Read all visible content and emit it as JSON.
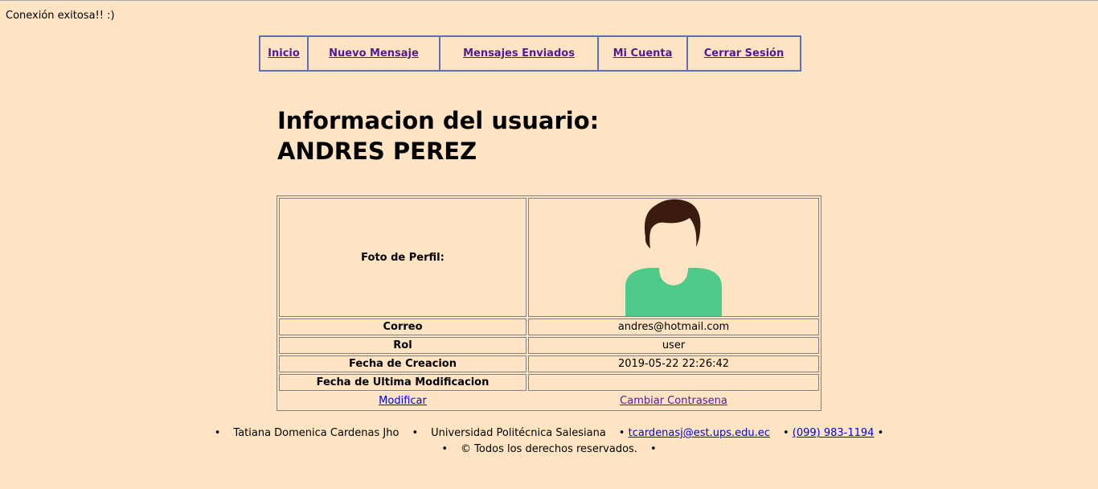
{
  "status_message": "Conexión exitosa!! :)",
  "nav": {
    "items": [
      {
        "label": "Inicio"
      },
      {
        "label": "Nuevo Mensaje"
      },
      {
        "label": "Mensajes Enviados"
      },
      {
        "label": "Mi Cuenta"
      },
      {
        "label": "Cerrar Sesión"
      }
    ]
  },
  "page_title": {
    "line1": "Informacion del usuario:",
    "line2": "ANDRES PEREZ"
  },
  "user_info": {
    "photo_label": "Foto de Perfil:",
    "rows": [
      {
        "label": "Correo",
        "value": "andres@hotmail.com"
      },
      {
        "label": "Rol",
        "value": "user"
      },
      {
        "label": "Fecha de Creacion",
        "value": "2019-05-22 22:26:42"
      },
      {
        "label": "Fecha de Ultima Modificacion",
        "value": ""
      }
    ],
    "modify_link": "Modificar",
    "change_password_link": "Cambiar Contrasena"
  },
  "footer": {
    "bullet": "•",
    "author": "Tatiana Domenica Cardenas Jho",
    "university": "Universidad Politécnica Salesiana",
    "email": "tcardenasj@est.ups.edu.ec",
    "phone": "(099) 983-1194",
    "copyright": "© Todos los derechos reservados."
  },
  "colors": {
    "background": "#ffe4c4",
    "nav_border": "#5f6fb5",
    "avatar_shirt": "#4ecb89",
    "avatar_hair": "#3b1b0e"
  }
}
